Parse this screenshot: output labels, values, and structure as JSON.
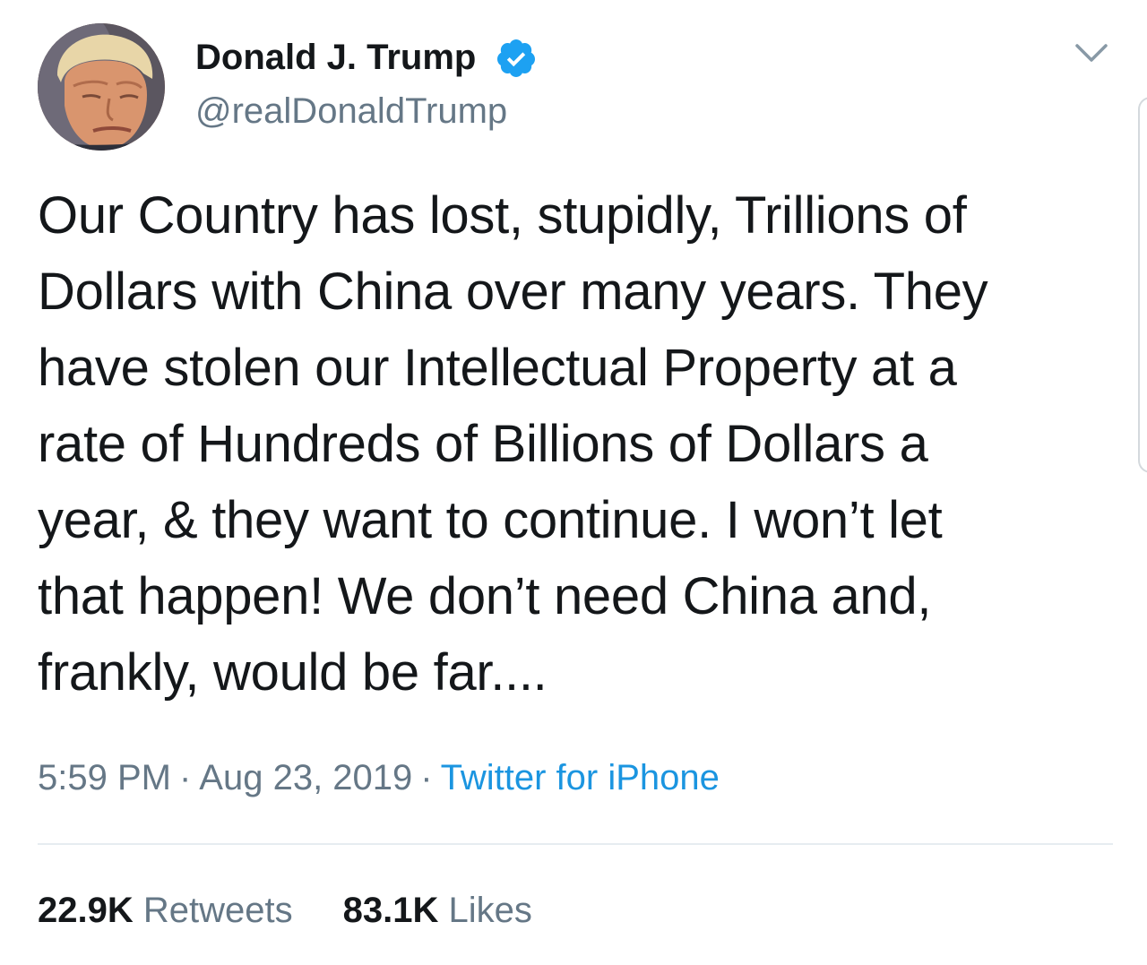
{
  "tweet": {
    "author": {
      "display_name": "Donald J. Trump",
      "handle": "@realDonaldTrump",
      "verified": true,
      "avatar_icon": "profile-photo",
      "verified_icon": "verified-badge-icon"
    },
    "menu_icon": "chevron-down-icon",
    "text": "Our Country has lost, stupidly, Trillions of\nDollars with China over many years. They\nhave stolen our Intellectual Property at a\nrate of Hundreds of Billions of Dollars a\nyear, & they want to continue. I won’t let\nthat happen! We don’t need China and,\nfrankly, would be far....",
    "time": "5:59 PM",
    "date": "Aug 23, 2019",
    "separator": "·",
    "source": "Twitter for iPhone",
    "stats": {
      "retweets_count": "22.9K",
      "retweets_label": "Retweets",
      "likes_count": "83.1K",
      "likes_label": "Likes"
    }
  },
  "colors": {
    "text": "#14171a",
    "secondary": "#657786",
    "link": "#1b95e0",
    "verified": "#1da1f2",
    "divider": "#e6ecf0"
  }
}
